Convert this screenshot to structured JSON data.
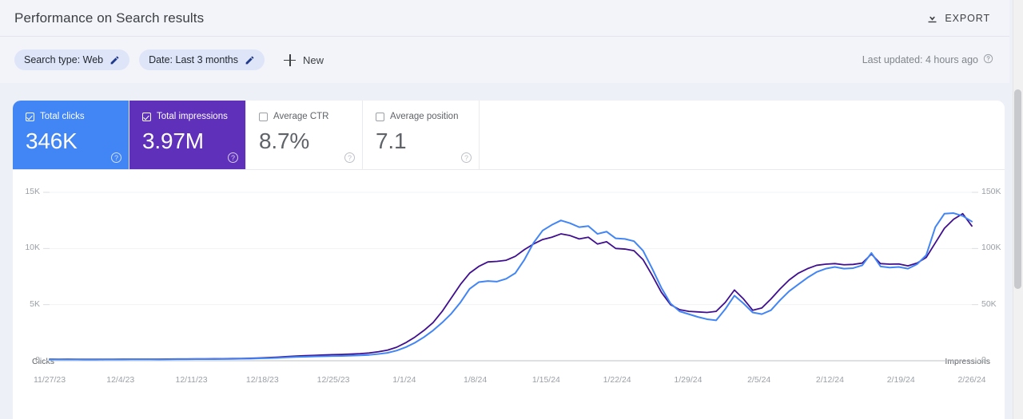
{
  "header": {
    "title": "Performance on Search results",
    "export_label": "EXPORT",
    "export_icon": "download-icon"
  },
  "filters": {
    "chips": [
      {
        "label": "Search type: Web",
        "edit_icon": "pencil-icon"
      },
      {
        "label": "Date: Last 3 months",
        "edit_icon": "pencil-icon"
      }
    ],
    "new_label": "New",
    "new_icon": "plus-icon",
    "last_updated": "Last updated: 4 hours ago",
    "help_icon": "help-circle-icon"
  },
  "metrics": [
    {
      "label": "Total clicks",
      "value": "346K",
      "checked": true,
      "color": "#4285f4",
      "help_icon": "help-circle-icon"
    },
    {
      "label": "Total impressions",
      "value": "3.97M",
      "checked": true,
      "color": "#5f31ba",
      "help_icon": "help-circle-icon"
    },
    {
      "label": "Average CTR",
      "value": "8.7%",
      "checked": false,
      "color": "#ffffff",
      "help_icon": "help-circle-icon"
    },
    {
      "label": "Average position",
      "value": "7.1",
      "checked": false,
      "color": "#ffffff",
      "help_icon": "help-circle-icon"
    }
  ],
  "chart_data": {
    "type": "line",
    "title": "Performance on Search results",
    "xlabel": "",
    "ylabel": "Clicks",
    "y2label": "Impressions",
    "grid": true,
    "legend_position": "none",
    "ylim": [
      0,
      15000
    ],
    "y2lim": [
      0,
      150000
    ],
    "yticks": [
      0,
      5000,
      10000,
      15000
    ],
    "ytick_labels": [
      "0",
      "5K",
      "10K",
      "15K"
    ],
    "y2ticks": [
      0,
      50000,
      100000,
      150000
    ],
    "y2tick_labels": [
      "0",
      "50K",
      "100K",
      "150K"
    ],
    "xtick_labels": [
      "11/27/23",
      "12/4/23",
      "12/11/23",
      "12/18/23",
      "12/25/23",
      "1/1/24",
      "1/8/24",
      "1/15/24",
      "1/22/24",
      "1/29/24",
      "2/5/24",
      "2/12/24",
      "2/19/24",
      "2/26/24"
    ],
    "x_start": "11/27/23",
    "x_end": "2/26/24",
    "n_points": 92,
    "series": [
      {
        "name": "Clicks",
        "color": "#4285f4",
        "axis": "left",
        "values": [
          120,
          115,
          118,
          112,
          110,
          108,
          112,
          115,
          118,
          120,
          122,
          120,
          118,
          125,
          130,
          135,
          140,
          138,
          142,
          150,
          160,
          175,
          190,
          210,
          230,
          260,
          300,
          340,
          360,
          380,
          400,
          420,
          430,
          450,
          480,
          520,
          600,
          700,
          900,
          1200,
          1600,
          2100,
          2700,
          3400,
          4200,
          5200,
          6400,
          7000,
          7100,
          7050,
          7300,
          7800,
          9000,
          10500,
          11600,
          12100,
          12500,
          12250,
          11900,
          12000,
          11300,
          11500,
          10900,
          10850,
          10650,
          9800,
          8200,
          6500,
          5100,
          4400,
          4150,
          3900,
          3700,
          3600,
          4600,
          5800,
          5100,
          4300,
          4150,
          4500,
          5400,
          6200,
          6800,
          7400,
          7900,
          8200,
          8350,
          8200,
          8250,
          8500,
          9600,
          8400,
          8300,
          8350,
          8200,
          8600,
          9400,
          11900,
          13100,
          13150,
          12900,
          12400
        ]
      },
      {
        "name": "Impressions",
        "color": "#3f0f8f",
        "axis": "right",
        "values": [
          1400,
          1350,
          1380,
          1320,
          1300,
          1290,
          1320,
          1360,
          1400,
          1420,
          1440,
          1420,
          1400,
          1480,
          1550,
          1620,
          1700,
          1680,
          1720,
          1800,
          1900,
          2050,
          2200,
          2500,
          2800,
          3200,
          3700,
          4200,
          4500,
          4800,
          5100,
          5400,
          5600,
          5900,
          6300,
          6900,
          8000,
          9400,
          12000,
          16000,
          21000,
          27000,
          34000,
          44000,
          56000,
          68000,
          78000,
          84000,
          88000,
          88500,
          89500,
          93000,
          99000,
          104000,
          108000,
          110000,
          113000,
          111500,
          108500,
          110000,
          104000,
          106000,
          100000,
          99500,
          98000,
          90000,
          76000,
          61000,
          50000,
          45500,
          44000,
          43500,
          43000,
          44000,
          52000,
          63000,
          55000,
          45000,
          47000,
          55000,
          64000,
          72000,
          78000,
          82000,
          85000,
          86000,
          86500,
          85500,
          85800,
          87000,
          95000,
          86500,
          86000,
          86200,
          84500,
          87000,
          92000,
          105000,
          118000,
          126000,
          131000,
          120000
        ]
      }
    ]
  },
  "scrollbar": {
    "name": "vertical-scrollbar"
  }
}
